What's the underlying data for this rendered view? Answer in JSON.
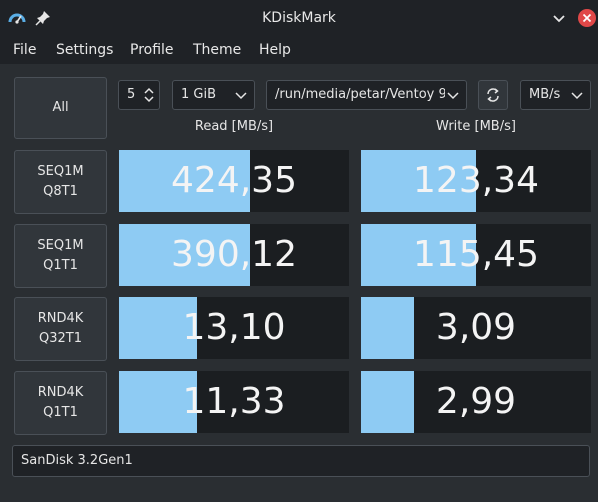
{
  "window": {
    "title": "KDiskMark"
  },
  "menu": [
    "File",
    "Settings",
    "Profile",
    "Theme",
    "Help"
  ],
  "controls": {
    "all_button": "All",
    "runs_value": "5",
    "size_value": "1 GiB",
    "path_value": "/run/media/petar/Ventoy 9",
    "unit_value": "MB/s"
  },
  "headers": {
    "read": "Read [MB/s]",
    "write": "Write [MB/s]"
  },
  "tests": [
    {
      "line1": "SEQ1M",
      "line2": "Q8T1",
      "read": "424,35",
      "read_fill": 0.57,
      "write": "123,34",
      "write_fill": 0.5
    },
    {
      "line1": "SEQ1M",
      "line2": "Q1T1",
      "read": "390,12",
      "read_fill": 0.57,
      "write": "115,45",
      "write_fill": 0.5
    },
    {
      "line1": "RND4K",
      "line2": "Q32T1",
      "read": "13,10",
      "read_fill": 0.34,
      "write": "3,09",
      "write_fill": 0.23
    },
    {
      "line1": "RND4K",
      "line2": "Q1T1",
      "read": "11,33",
      "read_fill": 0.34,
      "write": "2,99",
      "write_fill": 0.23
    }
  ],
  "status": {
    "device": "SanDisk 3.2Gen1"
  },
  "colors": {
    "bar_fill": "#8ecbf3",
    "close_button": "#e04848",
    "app_icon": "#5aaee6"
  },
  "icons": {
    "app": "kdiskmark-gauge-icon",
    "pin": "pin-icon",
    "minimize": "chevron-down-icon",
    "close": "close-icon",
    "refresh": "refresh-icon"
  }
}
